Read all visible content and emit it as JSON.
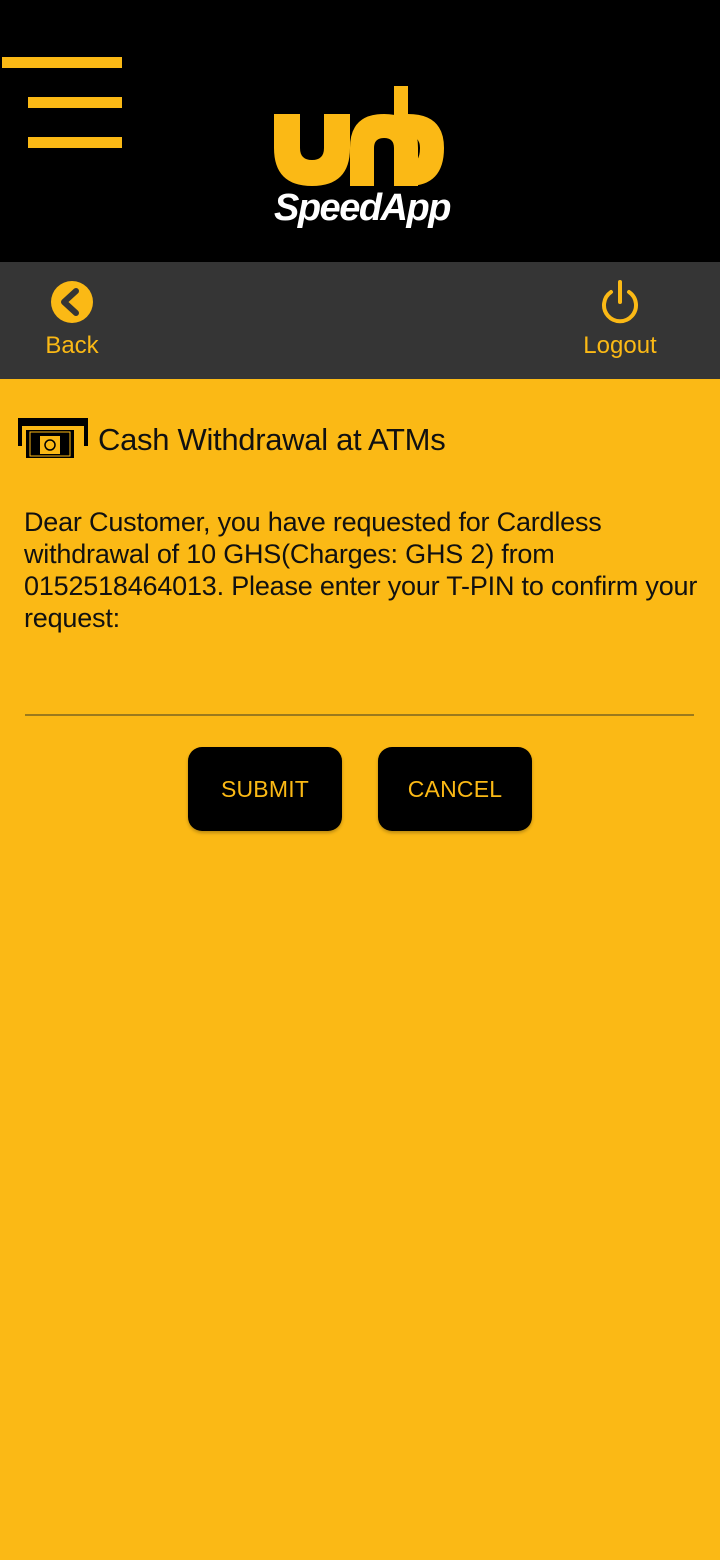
{
  "header": {
    "logo_brand": "umb",
    "logo_sub": "SpeedApp",
    "menu_icon": "hamburger-menu-icon"
  },
  "nav": {
    "back_label": "Back",
    "back_icon": "chevron-left-circle-icon",
    "logout_label": "Logout",
    "logout_icon": "power-icon"
  },
  "page": {
    "title": "Cash Withdrawal at ATMs",
    "title_icon": "atm-cash-icon",
    "message": "Dear Customer, you have requested for Cardless withdrawal of 10 GHS(Charges: GHS 2) from 0152518464013. Please enter your T-PIN to confirm your request:",
    "pin_value": "",
    "submit_label": "SUBMIT",
    "cancel_label": "CANCEL"
  },
  "colors": {
    "brand_yellow": "#FBB915",
    "header_black": "#000000",
    "nav_gray": "#353535",
    "button_black": "#000000"
  }
}
